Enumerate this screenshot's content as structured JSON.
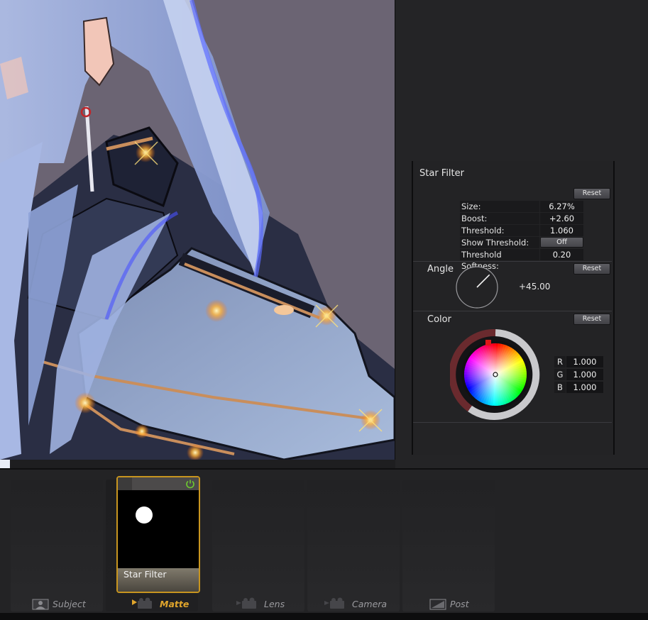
{
  "star_filter": {
    "title": "Star Filter",
    "reset_label": "Reset",
    "params": [
      {
        "label": "Size:",
        "value": "6.27%"
      },
      {
        "label": "Boost:",
        "value": "+2.60"
      },
      {
        "label": "Threshold:",
        "value": "1.060"
      },
      {
        "label": "Show Threshold:",
        "value": "Off"
      },
      {
        "label": "Threshold Softness:",
        "value": "0.20"
      }
    ]
  },
  "angle": {
    "label": "Angle",
    "reset_label": "Reset",
    "value": "+45.00",
    "degrees": 45
  },
  "color": {
    "label": "Color",
    "reset_label": "Reset",
    "channels": [
      {
        "name": "R",
        "value": "1.000"
      },
      {
        "name": "G",
        "value": "1.000"
      },
      {
        "name": "B",
        "value": "1.000"
      }
    ]
  },
  "tray": {
    "card": {
      "title": "Star Filter",
      "enabled": true
    },
    "tabs": [
      {
        "label": "Subject",
        "icon": "portrait-icon",
        "active": false
      },
      {
        "label": "Matte",
        "icon": "matte-camera-icon",
        "active": true
      },
      {
        "label": "Lens",
        "icon": "lens-camera-icon",
        "active": false
      },
      {
        "label": "Camera",
        "icon": "camera-icon",
        "active": false
      },
      {
        "label": "Post",
        "icon": "post-icon",
        "active": false
      }
    ]
  },
  "colors": {
    "accent": "#c8951f",
    "active_tab_text": "#e0a52c",
    "inactive_tab_text": "#9a9a9e"
  }
}
